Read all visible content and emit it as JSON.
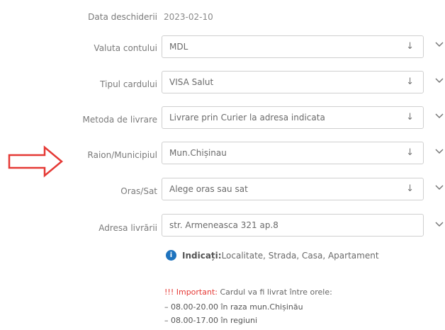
{
  "open_date": {
    "label": "Data deschiderii",
    "value": "2023-02-10"
  },
  "fields": [
    {
      "label": "Valuta contului",
      "value": "MDL",
      "arrow": "↓"
    },
    {
      "label": "Tipul cardului",
      "value": "VISA Salut",
      "arrow": "↓"
    },
    {
      "label": "Metoda de livrare",
      "value": "Livrare prin Curier la adresa indicata",
      "arrow": "↓"
    },
    {
      "label": "Raion/Municipiul",
      "value": "Mun.Chișinau",
      "arrow": "↓"
    },
    {
      "label": "Oras/Sat",
      "value": "Alege oras sau sat",
      "arrow": "↓"
    },
    {
      "label": "Adresa livrării",
      "value": "str. Armeneasca 321 ap.8"
    }
  ],
  "info": {
    "icon": "i",
    "bold": "Indicați:",
    "text": " Localitate, Strada, Casa, Apartament"
  },
  "important": {
    "marks": "!!!",
    "label": " Important:",
    "text": " Cardul va fi livrat între orele:",
    "lines": [
      "– 08.00-20.00 în raza mun.Chișinău",
      "– 08.00-17.00 în regiuni"
    ]
  },
  "colors": {
    "accent_red": "#e53935",
    "info_blue": "#1e73be"
  }
}
